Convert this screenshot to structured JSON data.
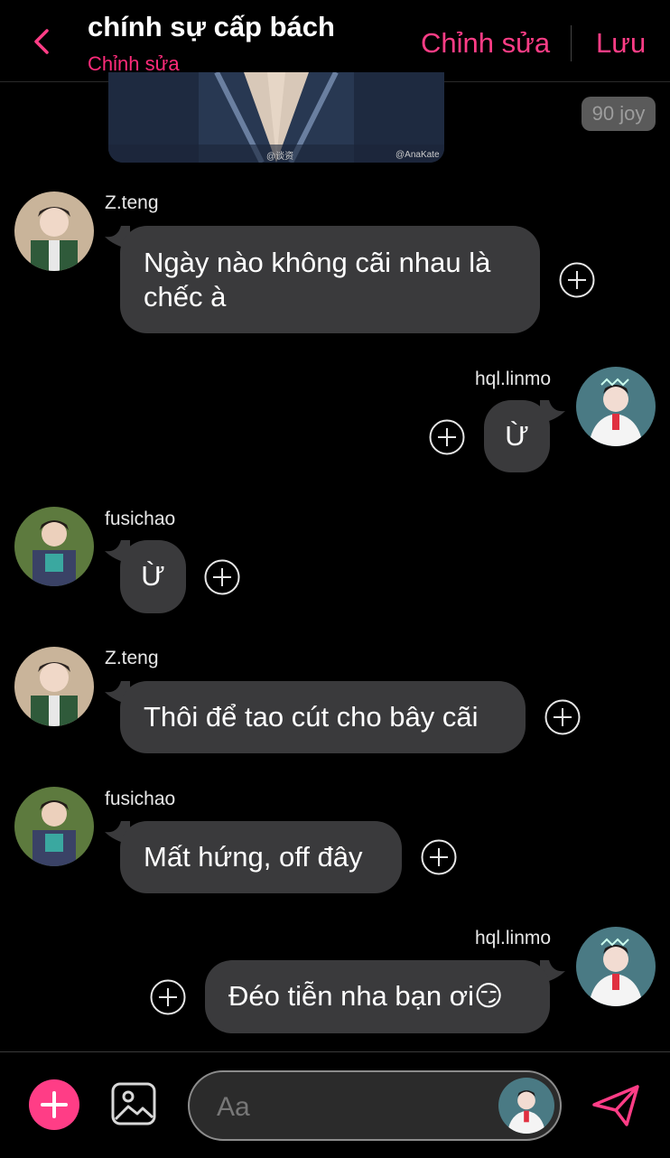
{
  "header": {
    "title": "chính sự cấp bách",
    "subtitle": "Chỉnh sửa",
    "edit_label": "Chỉnh sửa",
    "save_label": "Lưu"
  },
  "image_message": {
    "watermark_left": "@谈资",
    "watermark_right": "@AnaKate",
    "joy": "90 joy"
  },
  "messages": [
    {
      "user": "Z.teng",
      "line1": "Ngày nào không cãi nhau là",
      "line2": "chếc à"
    },
    {
      "user": "hql.linmo",
      "text": "Ừ"
    },
    {
      "user": "fusichao",
      "text": "Ừ"
    },
    {
      "user": "Z.teng",
      "text": "Thôi để tao cút cho bây cãi"
    },
    {
      "user": "fusichao",
      "text": "Mất hứng, off đây"
    },
    {
      "user": "hql.linmo",
      "text": "Đéo tiễn nha bạn ơi😏"
    }
  ],
  "composer": {
    "placeholder": "Aa"
  },
  "colors": {
    "accent": "#ff3d86",
    "bubble": "#3a3a3c",
    "background": "#000000"
  }
}
